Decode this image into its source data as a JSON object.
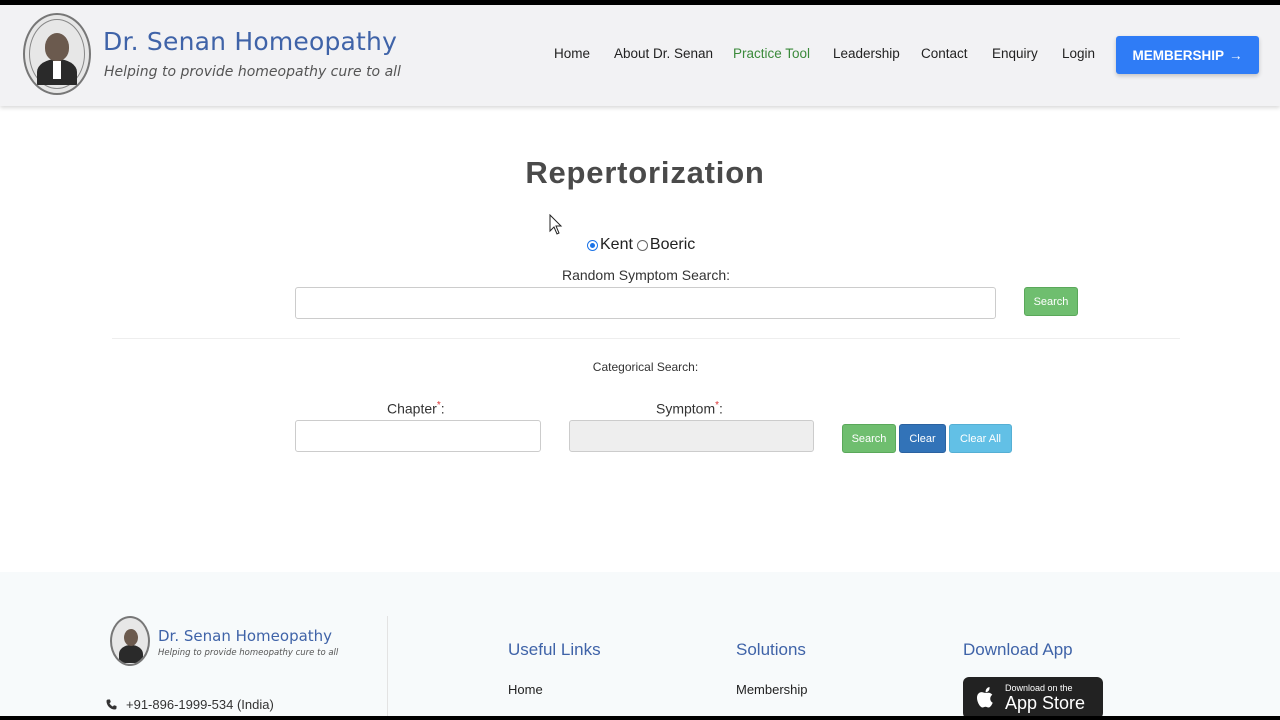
{
  "header": {
    "brand_title": "Dr. Senan Homeopathy",
    "brand_tagline": "Helping to provide homeopathy cure to all",
    "nav": [
      {
        "label": "Home"
      },
      {
        "label": "About Dr. Senan"
      },
      {
        "label": "Practice Tool",
        "active": true
      },
      {
        "label": "Leadership"
      },
      {
        "label": "Contact"
      },
      {
        "label": "Enquiry"
      },
      {
        "label": "Login"
      }
    ],
    "membership_button": "MEMBERSHIP",
    "membership_arrow": "→"
  },
  "main": {
    "title": "Repertorization",
    "radios": [
      {
        "label": "Kent",
        "checked": true
      },
      {
        "label": "Boeric",
        "checked": false
      }
    ],
    "random_search_label": "Random Symptom Search:",
    "random_search_value": "",
    "random_search_button": "Search",
    "categorical_label": "Categorical Search:",
    "chapter_label": "Chapter",
    "symptom_label": "Symptom",
    "required_mark": "*",
    "field_colon": ":",
    "search_button": "Search",
    "clear_button": "Clear",
    "clear_all_button": "Clear All"
  },
  "footer": {
    "brand_title": "Dr. Senan Homeopathy",
    "brand_tagline": "Helping to provide homeopathy cure to all",
    "phone": "+91-896-1999-534 (India)",
    "useful_links_heading": "Useful Links",
    "useful_links": [
      "Home"
    ],
    "solutions_heading": "Solutions",
    "solutions": [
      "Membership"
    ],
    "download_heading": "Download App",
    "appstore_small": "Download on the",
    "appstore_big": "App Store"
  },
  "colors": {
    "brand_blue": "#3f63a8",
    "membership_button": "#2f7cf6",
    "search_green": "#6fbe6f",
    "clear_blue": "#3273b8",
    "clear_all_cyan": "#62c0e6",
    "active_nav": "#3b8a3b"
  }
}
